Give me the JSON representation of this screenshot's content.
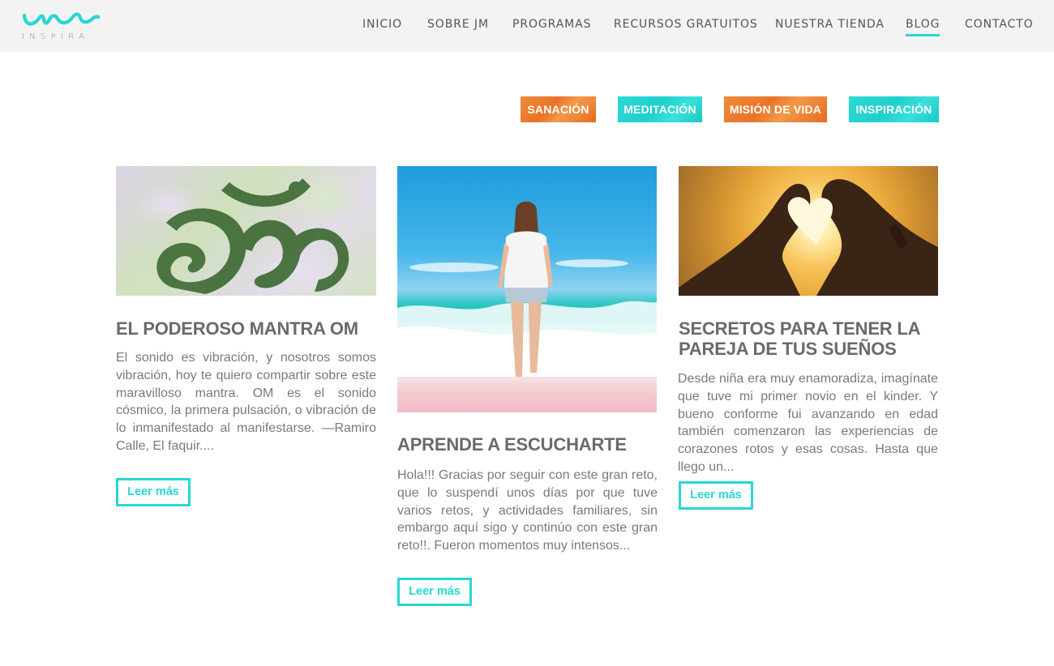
{
  "brand": {
    "logo_text": "INSPIRA",
    "accent_color": "#27d7d4",
    "orange_color": "#ec7a2c"
  },
  "nav": {
    "items": [
      {
        "label": "INICIO",
        "active": false
      },
      {
        "label": "SOBRE JM",
        "active": false
      },
      {
        "label": "PROGRAMAS",
        "active": false
      },
      {
        "label": "RECURSOS GRATUITOS",
        "active": false
      },
      {
        "label": "NUESTRA TIENDA",
        "active": false
      },
      {
        "label": "BLOG",
        "active": true
      },
      {
        "label": "CONTACTO",
        "active": false
      }
    ]
  },
  "categories": [
    {
      "label": "SANACIÓN",
      "color": "orange"
    },
    {
      "label": "MEDITACIÓN",
      "color": "cyan"
    },
    {
      "label": "MISIÓN DE VIDA",
      "color": "orange"
    },
    {
      "label": "INSPIRACIÓN",
      "color": "cyan"
    }
  ],
  "posts": [
    {
      "title": "EL PODEROSO MANTRA OM",
      "excerpt": "El sonido es vibración, y nosotros somos vibración, hoy te quiero compartir sobre este maravilloso mantra. OM es el sonido cósmico, la primera pulsación, o vibración de lo inmanifestado al manifestarse. —Ramiro Calle, El faquir....",
      "read_more": "Leer más",
      "image": "om-symbol-leaves"
    },
    {
      "title": "APRENDE A ESCUCHARTE",
      "excerpt": "Hola!!! Gracias por seguir con este gran reto, que lo suspendí unos días por que tuve varios retos, y actividades familiares, sin embargo aquí sigo y continúo con este gran reto!!. Fueron momentos muy intensos...",
      "read_more": "Leer más",
      "image": "woman-walking-beach"
    },
    {
      "title": "SECRETOS PARA TENER LA PAREJA DE TUS SUEÑOS",
      "excerpt": "Desde niña era muy enamoradiza, imagínate que tuve mi primer novio en el kinder. Y bueno conforme fui avanzando en edad también comenzaron las experiencias de corazones rotos y esas cosas. Hasta que llego un...",
      "read_more": "Leer más",
      "image": "hands-heart-sunset"
    }
  ]
}
